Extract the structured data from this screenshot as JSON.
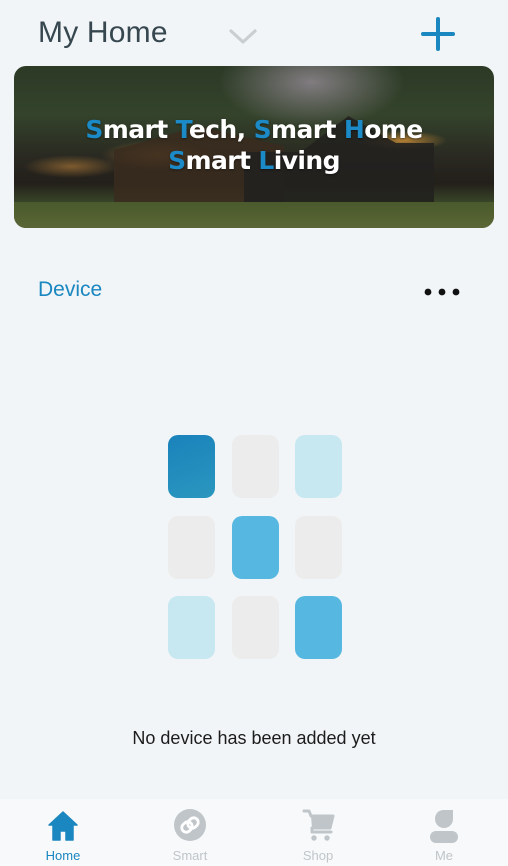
{
  "header": {
    "title": "My Home",
    "dropdown_icon": "chevron-down-icon",
    "add_icon": "plus-icon"
  },
  "banner": {
    "line1": [
      {
        "text": "S",
        "highlight": true
      },
      {
        "text": "mart ",
        "highlight": false
      },
      {
        "text": "T",
        "highlight": true
      },
      {
        "text": "ech, ",
        "highlight": false
      },
      {
        "text": "S",
        "highlight": true
      },
      {
        "text": "mart ",
        "highlight": false
      },
      {
        "text": "H",
        "highlight": true
      },
      {
        "text": "ome",
        "highlight": false
      }
    ],
    "line2": [
      {
        "text": "S",
        "highlight": true
      },
      {
        "text": "mart ",
        "highlight": false
      },
      {
        "text": "L",
        "highlight": true
      },
      {
        "text": "iving",
        "highlight": false
      }
    ],
    "full_text": "Smart Tech, Smart Home Smart Living"
  },
  "device_section": {
    "title": "Device",
    "more_icon": "more-horizontal-icon",
    "empty_message": "No device has been added yet",
    "illustration_tiles": [
      "dark-blue",
      "gray",
      "light-blue",
      "gray",
      "mid-blue",
      "gray",
      "light-blue",
      "gray",
      "mid-blue"
    ]
  },
  "colors": {
    "accent": "#1b87c0",
    "title_text": "#36474f",
    "inactive_tab": "#c0c5c9",
    "background": "#f1f5f7",
    "tile_dark_blue": "#1a82bb",
    "tile_mid_blue": "#56b8e1",
    "tile_light_blue": "#c7e8f1",
    "tile_gray": "#ececec"
  },
  "tabbar": {
    "items": [
      {
        "label": "Home",
        "icon": "home-icon",
        "active": true
      },
      {
        "label": "Smart",
        "icon": "smart-link-icon",
        "active": false
      },
      {
        "label": "Shop",
        "icon": "cart-icon",
        "active": false
      },
      {
        "label": "Me",
        "icon": "user-icon",
        "active": false
      }
    ]
  }
}
